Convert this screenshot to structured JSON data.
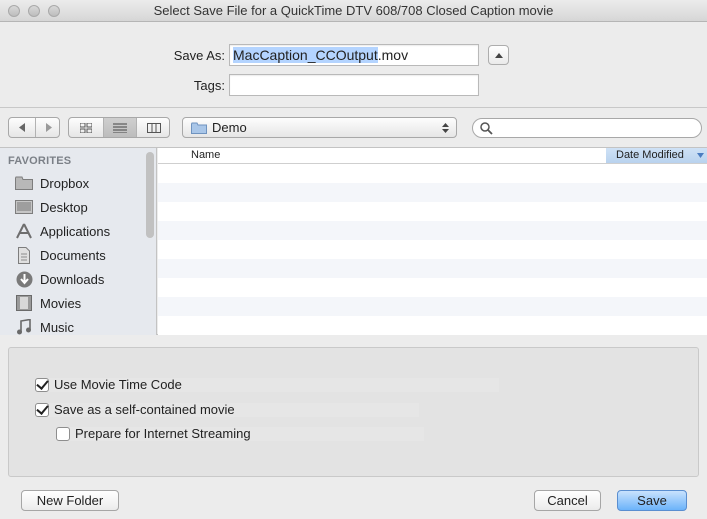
{
  "window": {
    "title": "Select Save File for a QuickTime DTV 608/708 Closed Caption movie"
  },
  "save_as": {
    "label": "Save As:",
    "value_selected": "MacCaption_CCOutput",
    "value_ext": ".mov"
  },
  "tags": {
    "label": "Tags:",
    "value": ""
  },
  "toolbar": {
    "location": "Demo",
    "search_placeholder": ""
  },
  "sidebar": {
    "heading": "FAVORITES",
    "items": [
      {
        "label": "Dropbox",
        "icon": "folder-icon"
      },
      {
        "label": "Desktop",
        "icon": "desktop-icon"
      },
      {
        "label": "Applications",
        "icon": "applications-icon"
      },
      {
        "label": "Documents",
        "icon": "documents-icon"
      },
      {
        "label": "Downloads",
        "icon": "downloads-icon"
      },
      {
        "label": "Movies",
        "icon": "movies-icon"
      },
      {
        "label": "Music",
        "icon": "music-icon"
      }
    ]
  },
  "file_list": {
    "columns": [
      "Name",
      "Date Modified"
    ],
    "sorted_column": "Date Modified",
    "rows": []
  },
  "options": {
    "use_movie_time_code": {
      "label": "Use Movie Time Code",
      "checked": true
    },
    "self_contained": {
      "label": "Save as a self-contained movie",
      "checked": true
    },
    "internet_streaming": {
      "label": "Prepare for Internet Streaming",
      "checked": false
    }
  },
  "buttons": {
    "new_folder": "New Folder",
    "cancel": "Cancel",
    "save": "Save"
  },
  "colors": {
    "selection": "#b4d4ff",
    "default_button": "#6cb3fa"
  }
}
